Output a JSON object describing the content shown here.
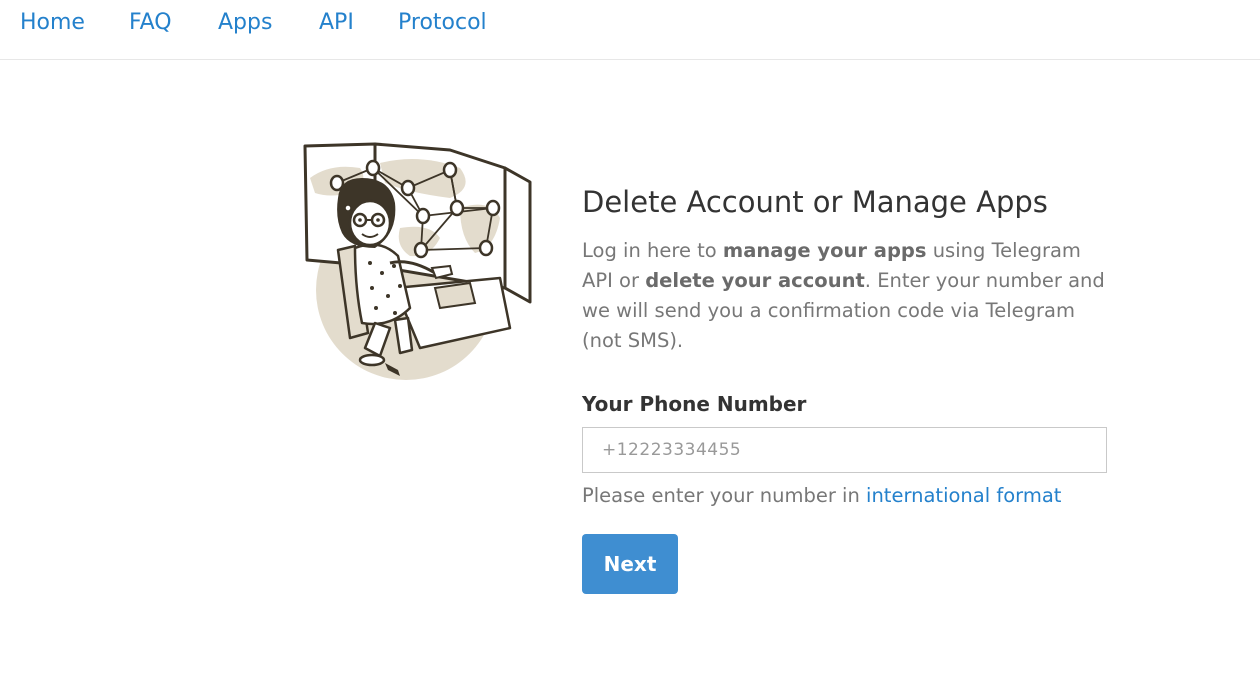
{
  "nav": {
    "items": [
      {
        "label": "Home"
      },
      {
        "label": "FAQ"
      },
      {
        "label": "Apps"
      },
      {
        "label": "API"
      },
      {
        "label": "Protocol"
      }
    ]
  },
  "main": {
    "title": "Delete Account or Manage Apps",
    "description": {
      "part1": "Log in here to ",
      "bold1": "manage your apps",
      "part2": " using Telegram API or ",
      "bold2": "delete your account",
      "part3": ". Enter your number and we will send you a confirmation code via Telegram (not SMS)."
    },
    "phone_label": "Your Phone Number",
    "phone_placeholder": "+12223334455",
    "phone_value": "",
    "hint_text": "Please enter your number in ",
    "hint_link": "international format",
    "next_label": "Next"
  },
  "illustration": {
    "icon": "telegram-woman-world-map-illustration",
    "colors": {
      "ink": "#3d3528",
      "fill": "#e3dccd",
      "paper": "#ffffff"
    }
  },
  "colors": {
    "accent": "#2481cc",
    "button": "#3f8ed1",
    "text_dark": "#333333",
    "text_muted": "#777777"
  }
}
